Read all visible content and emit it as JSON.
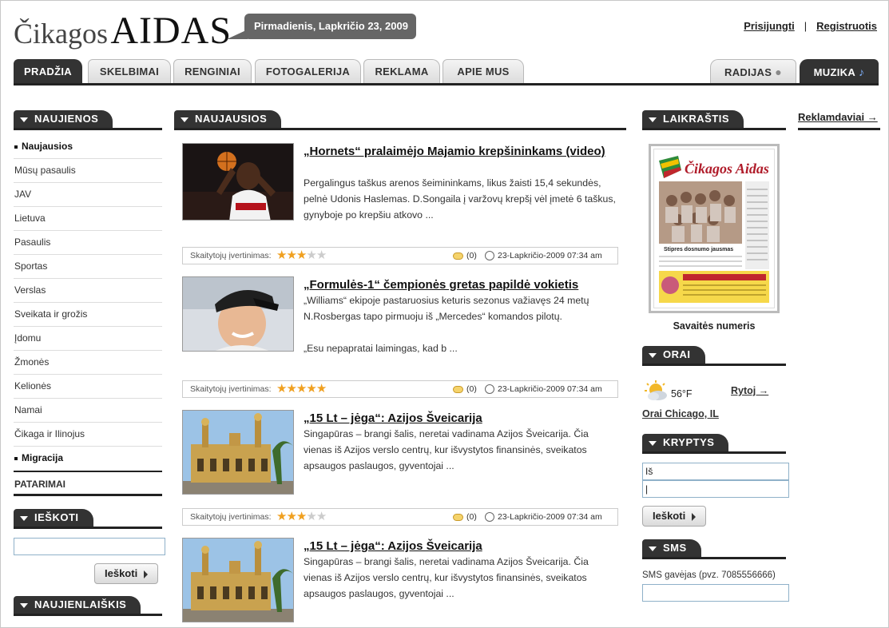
{
  "header": {
    "logo_prefix": "Čikagos",
    "logo_main": "AIDAS",
    "date": "Pirmadienis, Lapkričio 23, 2009",
    "login": "Prisijungti",
    "separator": "|",
    "register": "Registruotis"
  },
  "nav": {
    "tabs": [
      {
        "label": "PRADŽIA",
        "active": true
      },
      {
        "label": "SKELBIMAI"
      },
      {
        "label": "RENGINIAI"
      },
      {
        "label": "FOTOGALERIJA"
      },
      {
        "label": "REKLAMA"
      },
      {
        "label": "APIE MUS"
      },
      {
        "label": "RADIJAS",
        "icon": "microphone-icon"
      },
      {
        "label": "MUZIKA",
        "icon": "music-note-icon",
        "active": true
      }
    ]
  },
  "left": {
    "news_title": "NAUJIENOS",
    "menu": [
      "Naujausios",
      "Mūsų pasaulis",
      "JAV",
      "Lietuva",
      "Pasaulis",
      "Sportas",
      "Verslas",
      "Sveikata ir grožis",
      "Įdomu",
      "Žmonės",
      "Kelionės",
      "Namai",
      "Čikaga ir Ilinojus",
      "Migracija"
    ],
    "tips": "PATARIMAI",
    "search_title": "IEŠKOTI",
    "search_value": "",
    "search_btn": "Ieškoti",
    "newsletter_title": "NAUJIENLAIŠKIS"
  },
  "center": {
    "title": "NAUJAUSIOS",
    "rating_label": "Skaitytojų įvertinimas:",
    "articles": [
      {
        "title": "„Hornets“ pralaimėjo Majamio krepšininkams (video)",
        "text": "Pergalingus taškus arenos šeimininkams, likus žaisti 15,4 sekundės, pelnė Udonis Haslemas. D.Songaila į varžovų krepšį vėl įmetė 6 taškus, gynyboje po krepšiu atkovo ...",
        "rating": 3,
        "comments": "(0)",
        "date": "23-Lapkričio-2009 07:34 am",
        "image": "basketball-player-photo"
      },
      {
        "title": "„Formulės-1“ čempionės gretas papildė vokietis",
        "text": "„Williams“ ekipoje pastaruosius keturis sezonus važiavęs 24 metų N.Rosbergas tapo pirmuoju iš „Mercedes“ komandos pilotų.",
        "text2": "„Esu nepapratai laimingas, kad b ...",
        "rating": 5,
        "comments": "(0)",
        "date": "23-Lapkričio-2009 07:34 am",
        "image": "racing-driver-photo"
      },
      {
        "title": "„15 Lt – jėga“: Azijos Šveicarija",
        "text": "Singapūras – brangi šalis, neretai vadinama Azijos Šveicarija. Čia vienas iš Azijos verslo centrų, kur išvystytos finansinės, sveikatos apsaugos paslaugos, gyventojai ...",
        "rating": 3,
        "comments": "(0)",
        "date": "23-Lapkričio-2009 07:34 am",
        "image": "mosque-photo"
      },
      {
        "title": "„15 Lt – jėga“: Azijos Šveicarija",
        "text": "Singapūras – brangi šalis, neretai vadinama Azijos Šveicarija. Čia vienas iš Azijos verslo centrų, kur išvystytos finansinės, sveikatos apsaugos paslaugos, gyventojai ...",
        "image": "mosque-photo"
      }
    ]
  },
  "right": {
    "paper_title": "LAIKRAŠTIS",
    "paper_caption": "Savaitės numeris",
    "paper_masthead": "Čikagos Aidas",
    "paper_headline": "Stipres dosnumo jausmas",
    "weather_title": "ORAI",
    "temp": "56°F",
    "tomorrow": "Rytoj →",
    "weather_link": "Orai Chicago, IL",
    "dir_title": "KRYPTYS",
    "from_value": "Iš",
    "to_value": "|",
    "dir_btn": "Ieškoti",
    "sms_title": "SMS",
    "sms_label": "SMS gavėjas (pvz. 7085556666)"
  },
  "ads": {
    "link": "Reklamdaviai →"
  },
  "colors": {
    "dark": "#333333",
    "star": "#f0a020",
    "input_border": "#8fb1c9"
  }
}
